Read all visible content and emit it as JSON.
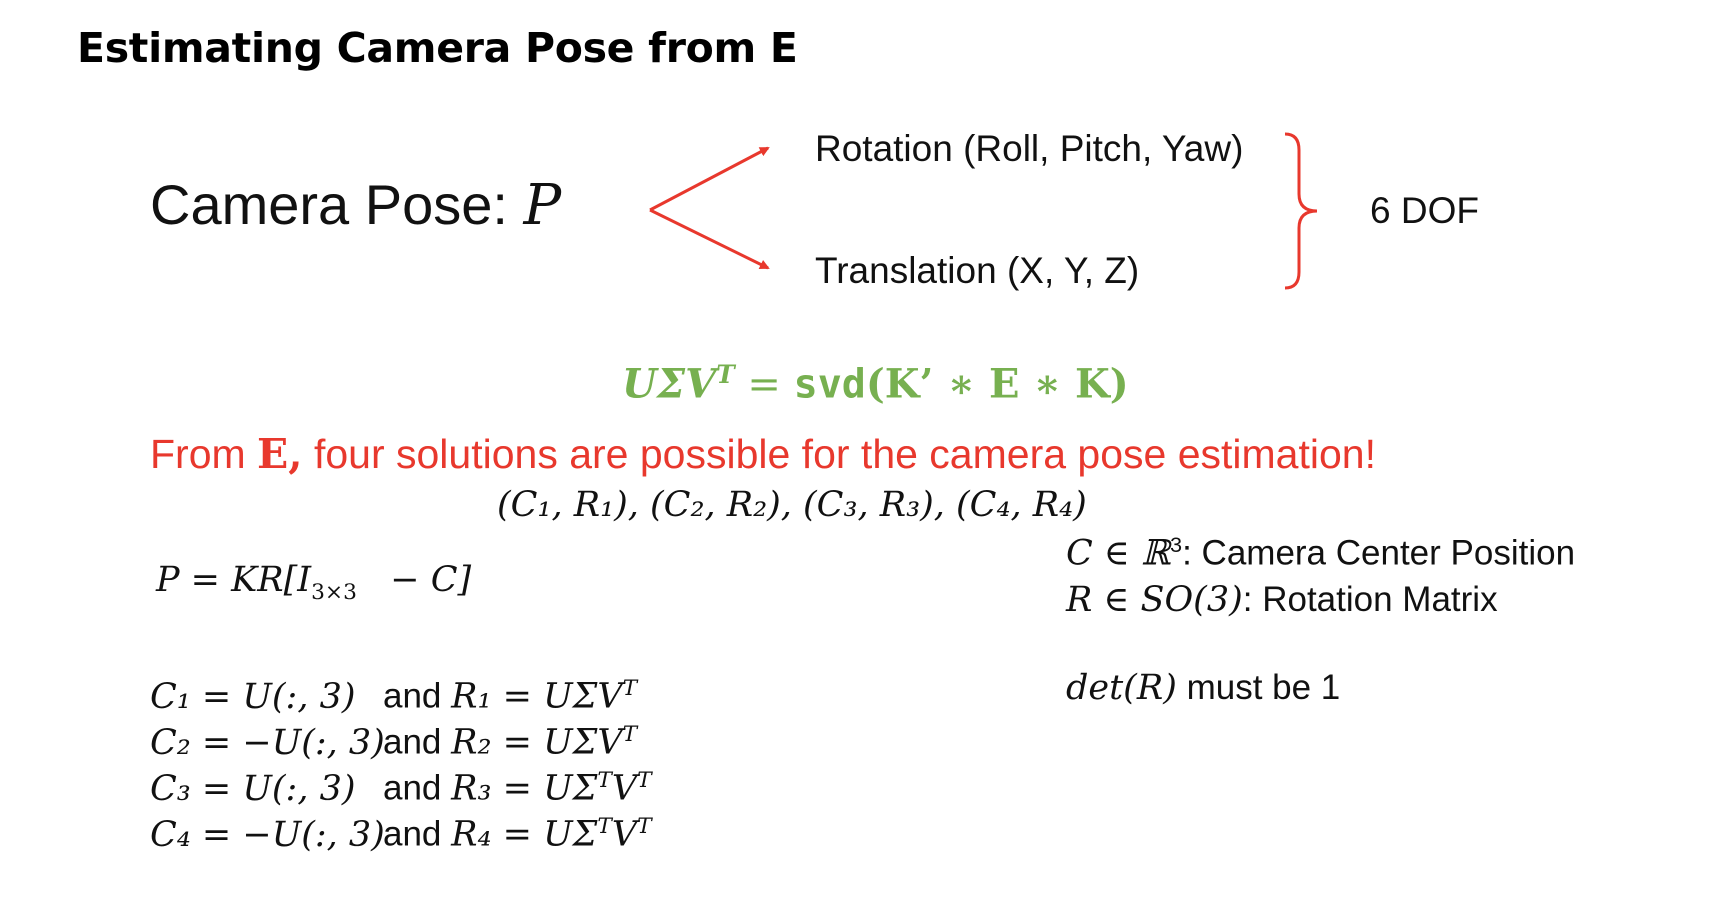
{
  "title": "Estimating Camera Pose from E",
  "pose": {
    "label": "Camera Pose: ",
    "symbol": "P",
    "rotation": "Rotation (Roll, Pitch, Yaw)",
    "translation": "Translation (X, Y, Z)",
    "dof": "6 DOF"
  },
  "svd_equation": {
    "lhs": "UΣV",
    "lhs_sup": "T",
    "equals": " = ",
    "func": "svd",
    "args": "(K’ ∗ E ∗ K)"
  },
  "statement": {
    "prefix": "From ",
    "E": "E,",
    "suffix": " four solutions are possible for the camera pose estimation!"
  },
  "pairs": "(C₁, R₁), (C₂, R₂), (C₃, R₃), (C₄, R₄)",
  "projection": {
    "lhs": "P = KR[I",
    "sub": "3×3",
    "rhs": "   − C]"
  },
  "definitions": {
    "center_math": "C ∈ ℝ",
    "center_sup": "3",
    "center_text": ": Camera Center Position",
    "rotation_math": "R ∈ SO(3)",
    "rotation_text": ": Rotation Matrix",
    "det_math": "det(R)",
    "det_text": " must be 1"
  },
  "solutions": [
    {
      "c": "C₁ = U(:, 3)",
      "and": "and",
      "r": "R₁ = UΣV",
      "r_sup": "T"
    },
    {
      "c": "C₂ = −U(:, 3)",
      "and": "and",
      "r": "R₂ = UΣV",
      "r_sup": "T"
    },
    {
      "c": "C₃ = U(:, 3)",
      "and": "and",
      "r": "R₃ = UΣ",
      "r_sup": "T",
      "r2": "V",
      "r2_sup": "T"
    },
    {
      "c": "C₄ = −U(:, 3)",
      "and": "and",
      "r": "R₄ = UΣ",
      "r_sup": "T",
      "r2": "V",
      "r2_sup": "T"
    }
  ],
  "colors": {
    "arrow": "#e8382d",
    "svd": "#77b050",
    "statement": "#e8382d"
  }
}
